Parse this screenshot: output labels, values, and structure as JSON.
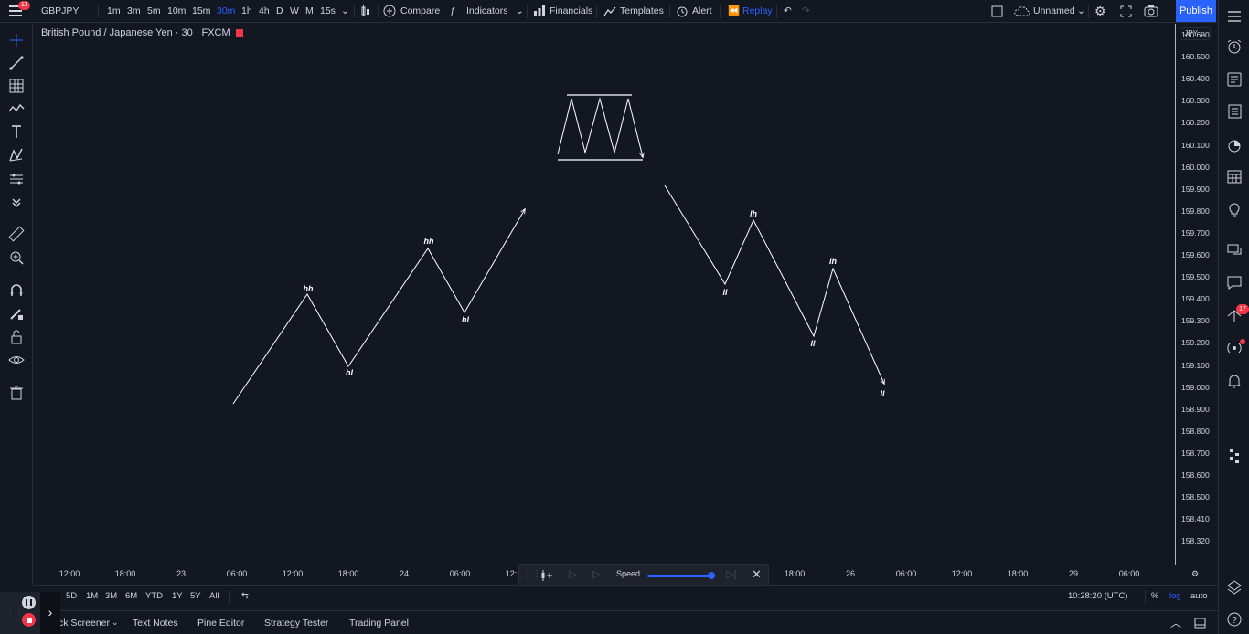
{
  "app": {
    "symbol": "GBPJPY",
    "notification_count": "11",
    "legend_title": "British Pound / Japanese Yen · 30 · FXCM",
    "layout_name": "Unnamed",
    "publish_label": "Publish",
    "currency": "JPY"
  },
  "toolbar": {
    "intervals": [
      "1m",
      "3m",
      "5m",
      "10m",
      "15m",
      "30m",
      "1h",
      "4h",
      "D",
      "W",
      "M",
      "15s"
    ],
    "active_interval": "30m",
    "compare_label": "Compare",
    "indicators_label": "Indicators",
    "financials_label": "Financials",
    "templates_label": "Templates",
    "alert_label": "Alert",
    "replay_label": "Replay"
  },
  "price_scale": [
    "160.600",
    "160.500",
    "160.400",
    "160.300",
    "160.200",
    "160.100",
    "160.000",
    "159.900",
    "159.800",
    "159.700",
    "159.600",
    "159.500",
    "159.400",
    "159.300",
    "159.200",
    "159.100",
    "159.000",
    "158.900",
    "158.800",
    "158.700",
    "158.600",
    "158.500",
    "158.410",
    "158.320"
  ],
  "time_axis": [
    "12:00",
    "18:00",
    "23",
    "06:00",
    "12:00",
    "18:00",
    "24",
    "06:00",
    "12:",
    "18:00",
    "26",
    "06:00",
    "12:00",
    "18:00",
    "29",
    "06:00"
  ],
  "drawings": {
    "labels": {
      "hh1": "hh",
      "hl1": "hl",
      "hh2": "hh",
      "hl2": "hl",
      "lh1": "lh",
      "ll1": "ll",
      "lh2": "lh",
      "ll2": "ll",
      "ll3": "ll"
    }
  },
  "replay_panel": {
    "speed_label": "Speed",
    "speed_level": 0.93
  },
  "ranges": {
    "items": [
      "5D",
      "1M",
      "3M",
      "6M",
      "YTD",
      "1Y",
      "5Y",
      "All"
    ],
    "clock": "10:28:20 (UTC)",
    "percent_label": "%",
    "log_label": "log",
    "auto_label": "auto"
  },
  "bottom_tabs": [
    "ck Screener",
    "Text Notes",
    "Pine Editor",
    "Strategy Tester",
    "Trading Panel"
  ],
  "right_badge": "17",
  "colors": {
    "background": "#131722",
    "accent": "#2962ff",
    "text": "#d1d4dc",
    "danger": "#f23645",
    "line": "#ffffff"
  }
}
